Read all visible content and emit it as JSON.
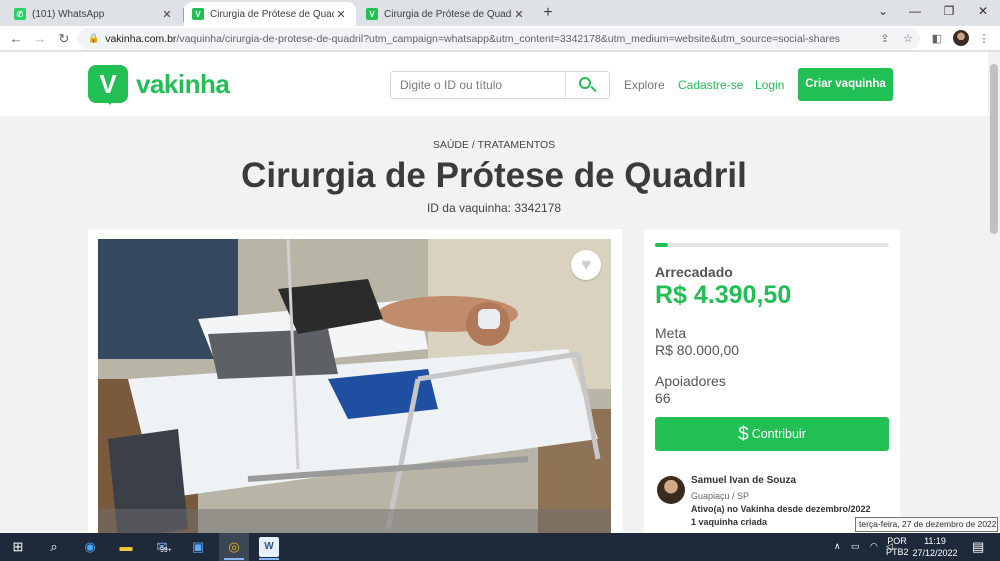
{
  "browser": {
    "tabs": [
      {
        "title": "(101) WhatsApp",
        "favicon_color": "#25d366",
        "favicon_glyph": "✆",
        "active": false
      },
      {
        "title": "Cirurgia de Prótese de Quadril | V",
        "favicon_color": "#22bf54",
        "favicon_glyph": "V",
        "active": true
      },
      {
        "title": "Cirurgia de Prótese de Quadril | V",
        "favicon_color": "#22bf54",
        "favicon_glyph": "V",
        "active": false
      }
    ],
    "url_domain": "vakinha.com.br",
    "url_path": "/vaquinha/cirurgia-de-protese-de-quadril?utm_campaign=whatsapp&utm_content=3342178&utm_medium=website&utm_source=social-shares"
  },
  "site": {
    "logo_glyph": "V",
    "logo_text": "vakinha",
    "search_placeholder": "Digite o ID ou título",
    "nav_explore": "Explore",
    "nav_signup": "Cadastre-se",
    "nav_login": "Login",
    "cta_label": "Criar vaquinha",
    "accent": "#22bf54"
  },
  "campaign": {
    "category": "SAÚDE / TRATAMENTOS",
    "title": "Cirurgia de Prótese de Quadril",
    "id_text": "ID da vaquinha: 3342178",
    "progress_fraction": 0.055,
    "raised_label": "Arrecadado",
    "raised_value": "R$ 4.390,50",
    "goal_label": "Meta",
    "goal_value": "R$ 80.000,00",
    "supporters_label": "Apoiadores",
    "supporters_value": "66",
    "contribute_label": "Contribuir",
    "owner": {
      "name": "Samuel Ivan de Souza",
      "location": "Guapiaçu / SP",
      "since": "Ativo(a) no Vakinha desde dezembro/2022",
      "count": "1 vaquinha criada"
    }
  },
  "taskbar": {
    "lang_top": "POR",
    "lang_bottom": "PTB2",
    "time": "11:19",
    "date": "27/12/2022",
    "tooltip": "terça-feira, 27 de dezembro de 2022",
    "mail_badge": "99+"
  }
}
